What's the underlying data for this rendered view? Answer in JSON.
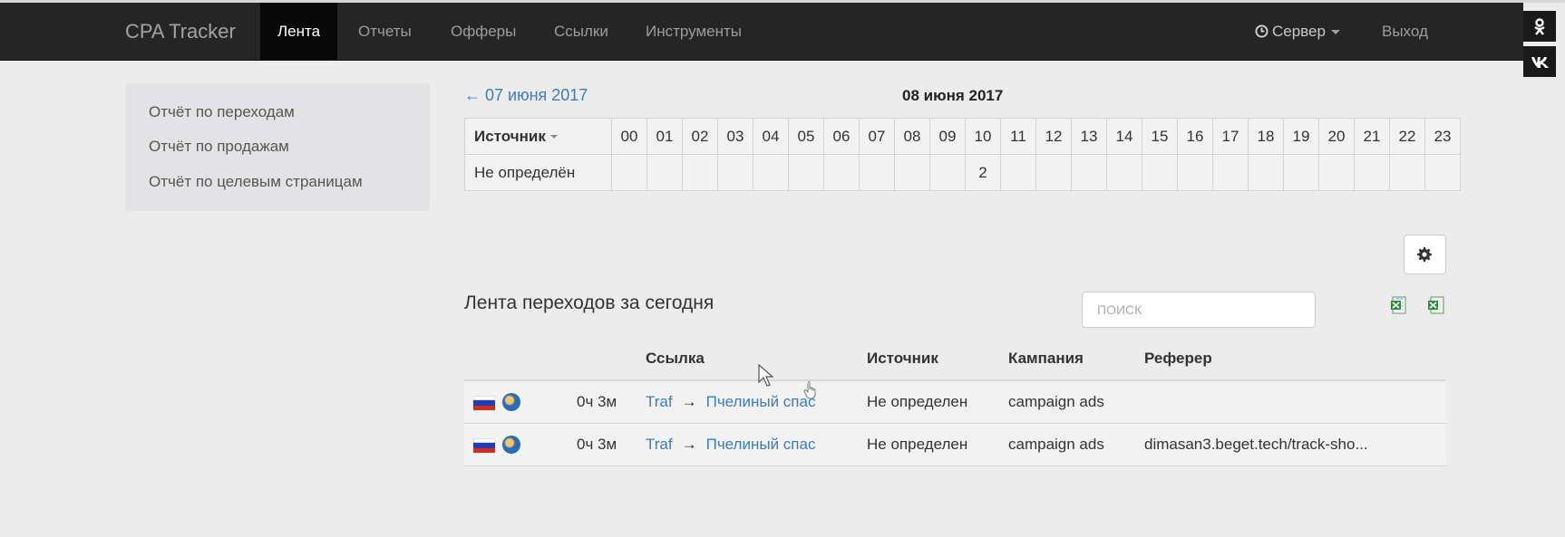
{
  "navbar": {
    "brand": "CPA Tracker",
    "items": [
      {
        "label": "Лента",
        "active": true
      },
      {
        "label": "Отчеты",
        "active": false
      },
      {
        "label": "Офферы",
        "active": false
      },
      {
        "label": "Ссылки",
        "active": false
      },
      {
        "label": "Инструменты",
        "active": false
      }
    ],
    "server_label": "Сервер",
    "logout_label": "Выход"
  },
  "social": {
    "icons": [
      "odnoklassniki-icon",
      "vk-icon"
    ]
  },
  "sidebar": {
    "items": [
      {
        "label": "Отчёт по переходам"
      },
      {
        "label": "Отчёт по продажам"
      },
      {
        "label": "Отчёт по целевым страницам"
      }
    ]
  },
  "dates": {
    "prev": "← 07 июня 2017",
    "current": "08 июня 2017"
  },
  "hours_table": {
    "source_header": "Источник",
    "hours": [
      "00",
      "01",
      "02",
      "03",
      "04",
      "05",
      "06",
      "07",
      "08",
      "09",
      "10",
      "11",
      "12",
      "13",
      "14",
      "15",
      "16",
      "17",
      "18",
      "19",
      "20",
      "21",
      "22",
      "23"
    ],
    "rows": [
      {
        "source": "Не определён",
        "values": [
          "",
          "",
          "",
          "",
          "",
          "",
          "",
          "",
          "",
          "",
          "2",
          "",
          "",
          "",
          "",
          "",
          "",
          "",
          "",
          "",
          "",
          "",
          "",
          ""
        ]
      }
    ]
  },
  "feed": {
    "title": "Лента переходов за сегодня",
    "search_placeholder": "поиск",
    "headers": {
      "link": "Ссылка",
      "source": "Источник",
      "campaign": "Кампания",
      "referer": "Реферер"
    },
    "rows": [
      {
        "flag": "ru",
        "time": "0ч 3м",
        "link_from": "Traf",
        "link_arrow": "→",
        "link_to": "Пчелиный спас",
        "source": "Не определен",
        "campaign": "campaign ads",
        "referer": ""
      },
      {
        "flag": "ru",
        "time": "0ч 3м",
        "link_from": "Traf",
        "link_arrow": "→",
        "link_to": "Пчелиный спас",
        "source": "Не определен",
        "campaign": "campaign ads",
        "referer": "dimasan3.beget.tech/track-sho..."
      }
    ]
  },
  "colors": {
    "navbar": "#252525",
    "active_nav": "#080808",
    "link": "#3a7dbf",
    "background": "#ececec"
  }
}
